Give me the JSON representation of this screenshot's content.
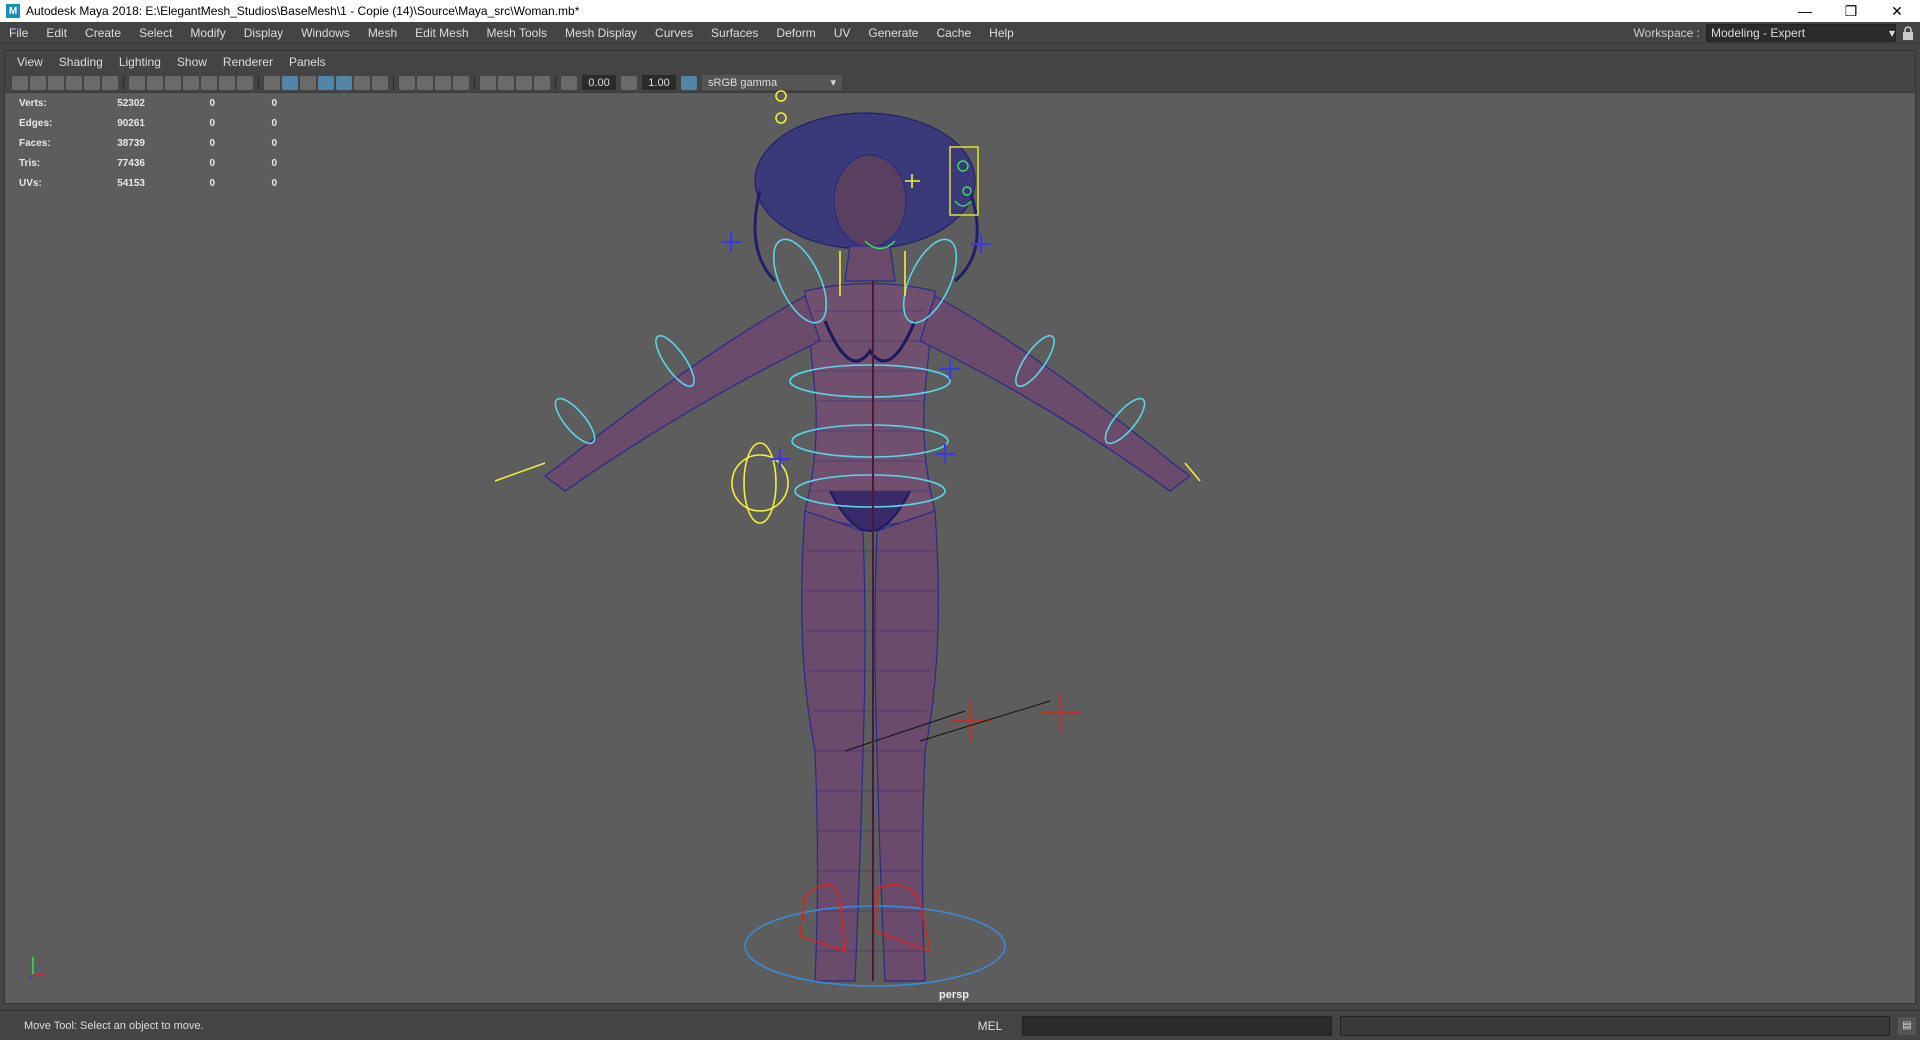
{
  "window": {
    "app_icon": "M",
    "title": "Autodesk Maya 2018: E:\\ElegantMesh_Studios\\BaseMesh\\1 - Copie (14)\\Source\\Maya_src\\Woman.mb*",
    "minimize": "—",
    "maximize": "❐",
    "close": "✕"
  },
  "menubar": {
    "items": [
      "File",
      "Edit",
      "Create",
      "Select",
      "Modify",
      "Display",
      "Windows",
      "Mesh",
      "Edit Mesh",
      "Mesh Tools",
      "Mesh Display",
      "Curves",
      "Surfaces",
      "Deform",
      "UV",
      "Generate",
      "Cache",
      "Help"
    ]
  },
  "workspace": {
    "label": "Workspace :",
    "value": "Modeling - Expert",
    "lock_icon": "lock-icon"
  },
  "panel_menu": {
    "items": [
      "View",
      "Shading",
      "Lighting",
      "Show",
      "Renderer",
      "Panels"
    ]
  },
  "panel_toolbar": {
    "exposure": "0.00",
    "gamma": "1.00",
    "color_space": "sRGB gamma"
  },
  "hud": {
    "rows": [
      {
        "label": "Verts:",
        "v1": "52302",
        "v2": "0",
        "v3": "0"
      },
      {
        "label": "Edges:",
        "v1": "90261",
        "v2": "0",
        "v3": "0"
      },
      {
        "label": "Faces:",
        "v1": "38739",
        "v2": "0",
        "v3": "0"
      },
      {
        "label": "Tris:",
        "v1": "77436",
        "v2": "0",
        "v3": "0"
      },
      {
        "label": "UVs:",
        "v1": "54153",
        "v2": "0",
        "v3": "0"
      }
    ]
  },
  "camera_label": "persp",
  "colors": {
    "viewport_bg": "#5d5d5d",
    "mesh_wire": "#2a2a8a",
    "ctrl_cyan": "#5bd3e8",
    "ctrl_yellow": "#f2ee3c",
    "ctrl_red": "#e02020",
    "ctrl_blue": "#3a3ae0"
  },
  "statusbar": {
    "message": "Move Tool: Select an object to move.",
    "mel_label": "MEL"
  }
}
